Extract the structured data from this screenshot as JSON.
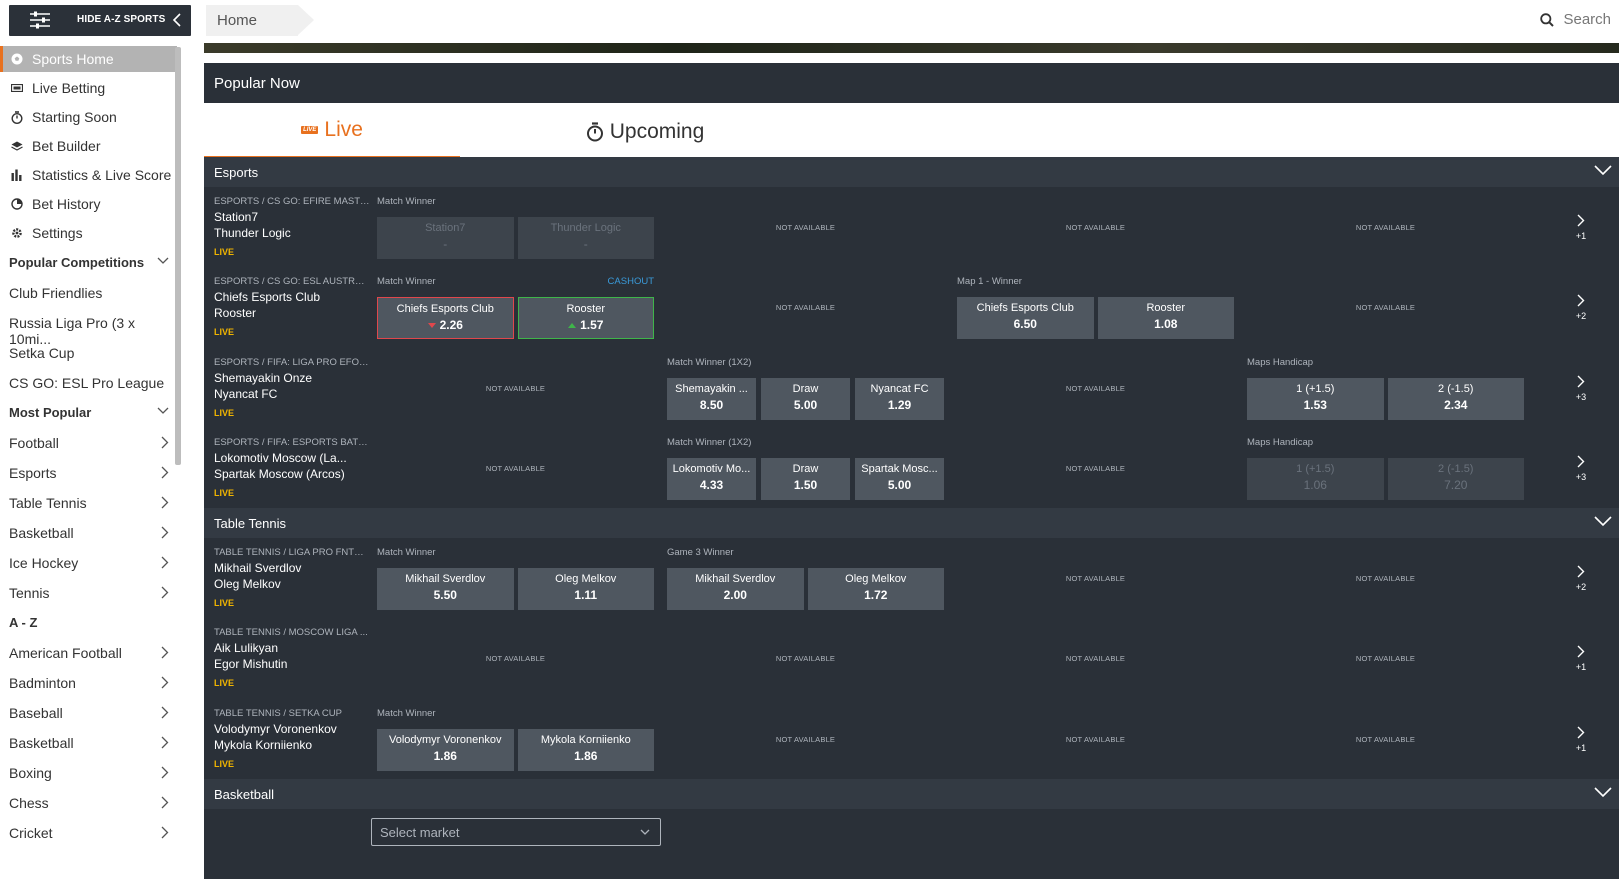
{
  "topbar": {
    "az_label": "HIDE A-Z SPORTS",
    "breadcrumb": "Home",
    "search_label": "Search"
  },
  "sidebar": {
    "nav": [
      {
        "label": "Sports Home",
        "icon": "soccer-ball-icon"
      },
      {
        "label": "Live Betting",
        "icon": "live-tv-icon"
      },
      {
        "label": "Starting Soon",
        "icon": "stopwatch-icon"
      },
      {
        "label": "Bet Builder",
        "icon": "layers-icon"
      },
      {
        "label": "Statistics & Live Score",
        "icon": "bar-chart-icon"
      },
      {
        "label": "Bet History",
        "icon": "history-icon"
      },
      {
        "label": "Settings",
        "icon": "gear-icon"
      }
    ],
    "popular_competitions_title": "Popular Competitions",
    "competitions": [
      "Club Friendlies",
      "Russia Liga Pro (3 x 10mi...",
      "Setka Cup",
      "CS GO: ESL Pro League"
    ],
    "most_popular_title": "Most Popular",
    "most_popular": [
      "Football",
      "Esports",
      "Table Tennis",
      "Basketball",
      "Ice Hockey",
      "Tennis"
    ],
    "az_title": "A - Z",
    "az": [
      "American Football",
      "Badminton",
      "Baseball",
      "Basketball",
      "Boxing",
      "Chess",
      "Cricket"
    ]
  },
  "main": {
    "popular_title": "Popular Now",
    "tabs": {
      "live_badge": "LIVE",
      "live": "Live",
      "upcoming": "Upcoming"
    },
    "not_available": "NOT AVAILABLE",
    "cashout": "CASHOUT",
    "sections": [
      "Esports",
      "Table Tennis",
      "Basketball"
    ],
    "select_market": "Select market"
  },
  "rows": [
    {
      "comp": "ESPORTS / CS GO: EFIRE MASTE...",
      "team1": "Station7",
      "team2": "Thunder Logic",
      "live": "LIVE",
      "more": "+1",
      "markets": [
        {
          "name": "Match Winner",
          "odds": [
            {
              "n": "Station7",
              "p": "-",
              "state": "disabled"
            },
            {
              "n": "Thunder Logic",
              "p": "-",
              "state": "disabled"
            }
          ]
        },
        null,
        null,
        null
      ]
    },
    {
      "comp": "ESPORTS / CS GO: ESL AUSTRALI...",
      "team1": "Chiefs Esports Club",
      "team2": "Rooster",
      "live": "LIVE",
      "more": "+2",
      "markets": [
        {
          "name": "Match Winner",
          "cashout": true,
          "odds": [
            {
              "n": "Chiefs Esports Club",
              "p": "2.26",
              "state": "down"
            },
            {
              "n": "Rooster",
              "p": "1.57",
              "state": "up"
            }
          ]
        },
        null,
        {
          "name": "Map 1 - Winner",
          "odds": [
            {
              "n": "Chiefs Esports Club",
              "p": "6.50"
            },
            {
              "n": "Rooster",
              "p": "1.08"
            }
          ]
        },
        null
      ]
    },
    {
      "comp": "ESPORTS / FIFA: LIGA PRO EFOO...",
      "team1": "Shemayakin Onze",
      "team2": "Nyancat FC",
      "live": "LIVE",
      "more": "+3",
      "markets": [
        null,
        {
          "name": "Match Winner (1X2)",
          "odds": [
            {
              "n": "Shemayakin ...",
              "p": "8.50"
            },
            {
              "n": "Draw",
              "p": "5.00"
            },
            {
              "n": "Nyancat FC",
              "p": "1.29"
            }
          ]
        },
        null,
        {
          "name": "Maps Handicap",
          "odds": [
            {
              "n": "1 (+1.5)",
              "p": "1.53"
            },
            {
              "n": "2 (-1.5)",
              "p": "2.34"
            }
          ]
        }
      ]
    },
    {
      "comp": "ESPORTS / FIFA: ESPORTS BATTLE",
      "team1": "Lokomotiv Moscow (La...",
      "team2": "Spartak Moscow (Arcos)",
      "live": "LIVE",
      "more": "+3",
      "markets": [
        null,
        {
          "name": "Match Winner (1X2)",
          "odds": [
            {
              "n": "Lokomotiv Mo...",
              "p": "4.33"
            },
            {
              "n": "Draw",
              "p": "1.50"
            },
            {
              "n": "Spartak Mosc...",
              "p": "5.00"
            }
          ]
        },
        null,
        {
          "name": "Maps Handicap",
          "odds": [
            {
              "n": "1 (+1.5)",
              "p": "1.06",
              "state": "disabled"
            },
            {
              "n": "2 (-1.5)",
              "p": "7.20",
              "state": "disabled"
            }
          ]
        }
      ]
    },
    {
      "comp": "TABLE TENNIS / LIGA PRO FNTR ...",
      "team1": "Mikhail Sverdlov",
      "team2": "Oleg Melkov",
      "live": "LIVE",
      "more": "+2",
      "markets": [
        {
          "name": "Match Winner",
          "odds": [
            {
              "n": "Mikhail Sverdlov",
              "p": "5.50"
            },
            {
              "n": "Oleg Melkov",
              "p": "1.11"
            }
          ]
        },
        {
          "name": "Game 3 Winner",
          "odds": [
            {
              "n": "Mikhail Sverdlov",
              "p": "2.00"
            },
            {
              "n": "Oleg Melkov",
              "p": "1.72"
            }
          ]
        },
        null,
        null
      ]
    },
    {
      "comp": "TABLE TENNIS / MOSCOW LIGA ...",
      "team1": "Aik Lulikyan",
      "team2": "Egor Mishutin",
      "live": "LIVE",
      "more": "+1",
      "markets": [
        null,
        null,
        null,
        null
      ]
    },
    {
      "comp": "TABLE TENNIS / SETKA CUP",
      "team1": "Volodymyr Voronenkov",
      "team2": "Mykola Korniienko",
      "live": "LIVE",
      "more": "+1",
      "markets": [
        {
          "name": "Match Winner",
          "odds": [
            {
              "n": "Volodymyr Voronenkov",
              "p": "1.86"
            },
            {
              "n": "Mykola Korniienko",
              "p": "1.86"
            }
          ]
        },
        null,
        null,
        null
      ]
    }
  ]
}
